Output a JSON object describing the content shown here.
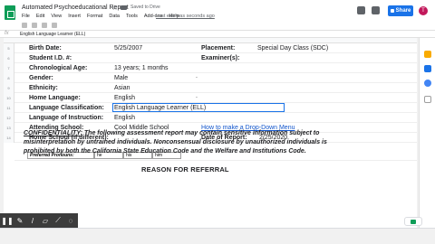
{
  "window": {
    "title": "Automated Psychoeducational Report",
    "save_status": "Saved to Drive",
    "last_edit": "Last edit was seconds ago"
  },
  "menu": [
    "File",
    "Edit",
    "View",
    "Insert",
    "Format",
    "Data",
    "Tools",
    "Add-ons",
    "Help"
  ],
  "share_label": "Share",
  "avatar_initial": "T",
  "formula_bar": {
    "fx": "fx",
    "content": "English Language Learner (ELL)"
  },
  "rows": [
    {
      "num": "5",
      "label": "Birth Date:",
      "value": "5/25/2007",
      "rlabel": "Placement:",
      "rvalue": "Special Day Class (SDC)"
    },
    {
      "num": "6",
      "label": "Student I.D. #:",
      "value": "",
      "rlabel": "Examiner(s):",
      "rvalue": ""
    },
    {
      "num": "7",
      "label": "Chronological Age:",
      "value": "13 years; 1 months",
      "rlabel": "",
      "rvalue": ""
    },
    {
      "num": "8",
      "label": "Gender:",
      "value": "Male",
      "rlabel": "",
      "rvalue": ""
    },
    {
      "num": "9",
      "label": "Ethnicity:",
      "value": "Asian",
      "rlabel": "",
      "rvalue": ""
    },
    {
      "num": "10",
      "label": "Home Language:",
      "value": "English",
      "rlabel": "",
      "rvalue": ""
    },
    {
      "num": "11",
      "label": "Language Classification:",
      "value": "English Language Learner (ELL)",
      "rlabel": "",
      "rvalue": ""
    },
    {
      "num": "12",
      "label": "Language of Instruction:",
      "value": "English",
      "rlabel": "",
      "rvalue": ""
    },
    {
      "num": "13",
      "label": "Attending School:",
      "value": "Cool Middle School",
      "rlabel": "How to make a Drop-Down Menu",
      "rvalue": ""
    },
    {
      "num": "14",
      "label": "Home School (if different):",
      "value": "",
      "rlabel": "Date of  Report:",
      "rvalue": "2/25/2020"
    }
  ],
  "pronouns": {
    "label": "Preferred Pronouns:",
    "values": [
      "he",
      "his",
      "him"
    ]
  },
  "confidentiality": {
    "heading": "CONFIDENTIALITY:",
    "text": " The following assessment report may contain sensitive information subject to misinterpretation by untrained individuals. Nonconsensual disclosure by unauthorized individuals is prohibited by both the California State Education Code and the Welfare and Institutions Code."
  },
  "section_heading": "REASON FOR REFERRAL",
  "colors": {
    "accent": "#1a73e8",
    "sheets_green": "#0f9d58",
    "link": "#1155cc"
  },
  "icons": {
    "app": "google-sheets-icon",
    "star": "star-icon",
    "folder": "folder-icon",
    "comments": "comment-icon",
    "present": "present-icon",
    "lock": "lock-icon"
  }
}
